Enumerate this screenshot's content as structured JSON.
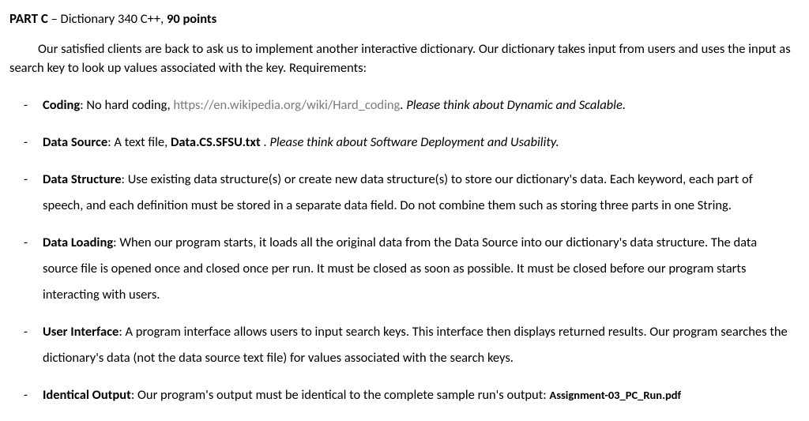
{
  "heading": {
    "part_label": "PART C",
    "dash": " – ",
    "course": "Dictionary 340 C++, ",
    "points": "90 points"
  },
  "intro": {
    "text": "Our satisfied clients are back to ask us to implement another interactive dictionary. Our dictionary takes input from users and uses the input as search key to look up values associated with the key. Requirements:"
  },
  "items": {
    "coding": {
      "label": "Coding",
      "sep": ": ",
      "pre": "No hard coding, ",
      "link": "https://en.wikipedia.org/wiki/Hard_coding",
      "post_link": ".  ",
      "ital": "Please think about Dynamic and Scalable."
    },
    "datasource": {
      "label": "Data Source",
      "sep": ": ",
      "pre": "A text file, ",
      "file": "Data.CS.SFSU.txt",
      "post_file": " . ",
      "ital": "Please think about Software Deployment and Usability."
    },
    "datastructure": {
      "label": "Data Structure",
      "sep": ": ",
      "text": "Use existing data structure(s) or create new data structure(s) to store our dictionary's data. Each keyword, each part of speech, and each definition must be stored in a separate data field. Do not combine them such as storing three parts in one String."
    },
    "dataloading": {
      "label": "Data Loading",
      "sep": ": ",
      "text": "When our program starts, it loads all the original data from the Data Source into our dictionary's data structure. The data source file is opened once and closed once per run. It must be closed as soon as possible. It must be closed before our program starts interacting with users."
    },
    "ui": {
      "label": "User Interface",
      "sep": ": ",
      "text": "A program interface allows users to input search keys. This interface then displays returned results. Our program searches the dictionary's data (not the data source text file) for values associated with the search keys."
    },
    "identical": {
      "label": "Identical Output",
      "sep": ": ",
      "text": "Our program's output must be identical to the complete sample run's output: ",
      "file": "Assignment-03_PC_Run.pdf"
    }
  }
}
